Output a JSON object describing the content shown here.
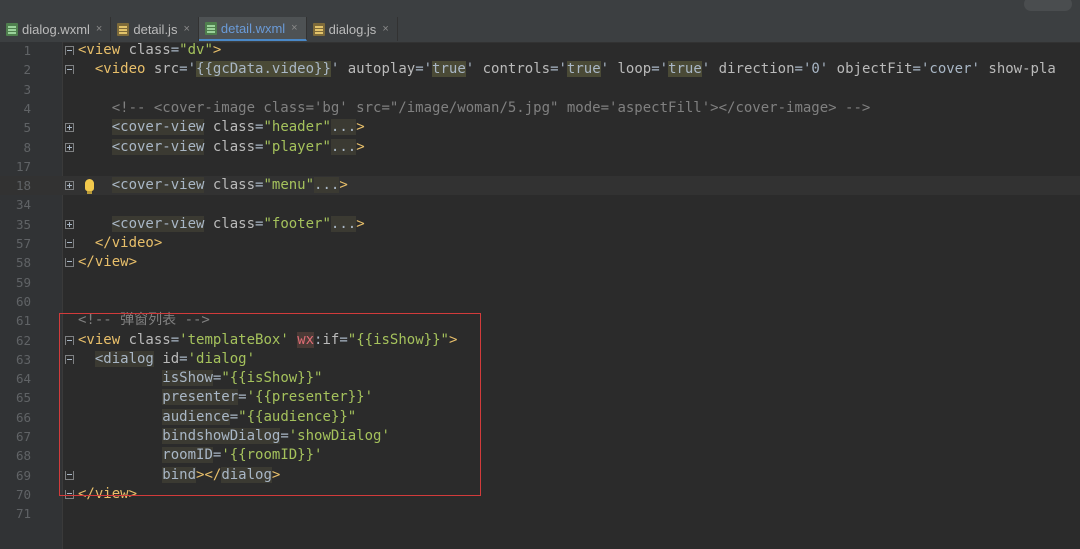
{
  "tabs": [
    {
      "label": "dialog.wxml",
      "icon": "wxml-file-icon",
      "active": false
    },
    {
      "label": "detail.js",
      "icon": "js-file-icon",
      "active": false
    },
    {
      "label": "detail.wxml",
      "icon": "wxml-file-icon",
      "active": true
    },
    {
      "label": "dialog.js",
      "icon": "js-file-icon",
      "active": false
    }
  ],
  "close_glyph": "×",
  "lines": [
    {
      "num": "1",
      "fold": "start",
      "segs": [
        [
          "tg",
          "<view "
        ],
        [
          "at",
          "class"
        ],
        [
          "",
          "="
        ],
        [
          "st",
          "\"dv\""
        ],
        [
          "tg",
          ">"
        ]
      ]
    },
    {
      "num": "2",
      "fold": "start",
      "segs": [
        [
          "",
          "  "
        ],
        [
          "tg",
          "<video "
        ],
        [
          "at",
          "src"
        ],
        [
          "",
          "='"
        ],
        [
          "hl2",
          "{{gcData.video}}"
        ],
        [
          "",
          "' "
        ],
        [
          "at",
          "autoplay"
        ],
        [
          "",
          "='"
        ],
        [
          "hl2",
          "true"
        ],
        [
          "",
          "' "
        ],
        [
          "at",
          "controls"
        ],
        [
          "",
          "='"
        ],
        [
          "hl2",
          "true"
        ],
        [
          "",
          "' "
        ],
        [
          "at",
          "loop"
        ],
        [
          "",
          "='"
        ],
        [
          "hl2",
          "true"
        ],
        [
          "",
          "' "
        ],
        [
          "at",
          "direction"
        ],
        [
          "",
          "='0' "
        ],
        [
          "at",
          "objectFit"
        ],
        [
          "",
          "='cover' "
        ],
        [
          "at",
          "show-pla"
        ]
      ]
    },
    {
      "num": "3",
      "fold": "",
      "segs": []
    },
    {
      "num": "4",
      "fold": "",
      "segs": [
        [
          "",
          "    "
        ],
        [
          "cm",
          "<!-- <cover-image class='bg' src=\"/image/woman/5.jpg\" mode='aspectFill'></cover-image> -->"
        ]
      ]
    },
    {
      "num": "5",
      "fold": "plus",
      "segs": [
        [
          "",
          "    "
        ],
        [
          "hl",
          "<cover-view"
        ],
        [
          "",
          " "
        ],
        [
          "at",
          "class"
        ],
        [
          "",
          "="
        ],
        [
          "st",
          "\"header\""
        ],
        [
          "hl",
          "..."
        ],
        [
          "tg",
          ">"
        ]
      ]
    },
    {
      "num": "8",
      "fold": "plus",
      "segs": [
        [
          "",
          "    "
        ],
        [
          "hl",
          "<cover-view"
        ],
        [
          "",
          " "
        ],
        [
          "at",
          "class"
        ],
        [
          "",
          "="
        ],
        [
          "st",
          "\"player\""
        ],
        [
          "hl",
          "..."
        ],
        [
          "tg",
          ">"
        ]
      ]
    },
    {
      "num": "17",
      "fold": "",
      "segs": []
    },
    {
      "num": "18",
      "fold": "plus",
      "bulb": true,
      "current": true,
      "segs": [
        [
          "",
          "    "
        ],
        [
          "hl",
          "<cover-view"
        ],
        [
          "",
          " "
        ],
        [
          "at",
          "class"
        ],
        [
          "",
          "="
        ],
        [
          "st",
          "\"menu\""
        ],
        [
          "hl",
          "..."
        ],
        [
          "tg",
          ">"
        ]
      ]
    },
    {
      "num": "34",
      "fold": "",
      "segs": []
    },
    {
      "num": "35",
      "fold": "plus",
      "segs": [
        [
          "",
          "    "
        ],
        [
          "hl",
          "<cover-view"
        ],
        [
          "",
          " "
        ],
        [
          "at",
          "class"
        ],
        [
          "",
          "="
        ],
        [
          "st",
          "\"footer\""
        ],
        [
          "hl",
          "..."
        ],
        [
          "tg",
          ">"
        ]
      ]
    },
    {
      "num": "57",
      "fold": "end",
      "segs": [
        [
          "",
          "  "
        ],
        [
          "tg",
          "</video>"
        ]
      ]
    },
    {
      "num": "58",
      "fold": "end",
      "segs": [
        [
          "tg",
          "</view>"
        ]
      ]
    },
    {
      "num": "59",
      "fold": "",
      "segs": []
    },
    {
      "num": "60",
      "fold": "",
      "segs": []
    },
    {
      "num": "61",
      "fold": "",
      "segs": [
        [
          "cm",
          "<!-- 弹窗列表 -->"
        ]
      ]
    },
    {
      "num": "62",
      "fold": "start",
      "segs": [
        [
          "tg",
          "<view "
        ],
        [
          "at",
          "class"
        ],
        [
          "",
          "="
        ],
        [
          "st",
          "'templateBox'"
        ],
        [
          "",
          " "
        ],
        [
          "wx",
          "wx"
        ],
        [
          "",
          ":"
        ],
        [
          "at",
          "if"
        ],
        [
          "",
          "="
        ],
        [
          "st",
          "\"{{isShow}}\""
        ],
        [
          "tg",
          ">"
        ]
      ]
    },
    {
      "num": "63",
      "fold": "start",
      "segs": [
        [
          "",
          "  "
        ],
        [
          "hl",
          "<dialog"
        ],
        [
          "",
          " "
        ],
        [
          "at",
          "id"
        ],
        [
          "",
          "="
        ],
        [
          "st",
          "'dialog'"
        ]
      ]
    },
    {
      "num": "64",
      "fold": "",
      "segs": [
        [
          "",
          "          "
        ],
        [
          "hl",
          "isShow"
        ],
        [
          "",
          "="
        ],
        [
          "st",
          "\"{{isShow}}\""
        ]
      ]
    },
    {
      "num": "65",
      "fold": "",
      "segs": [
        [
          "",
          "          "
        ],
        [
          "hl",
          "presenter"
        ],
        [
          "",
          "="
        ],
        [
          "st",
          "'{{presenter}}'"
        ]
      ]
    },
    {
      "num": "66",
      "fold": "",
      "segs": [
        [
          "",
          "          "
        ],
        [
          "hl",
          "audience"
        ],
        [
          "",
          "="
        ],
        [
          "st",
          "\"{{audience}}\""
        ]
      ]
    },
    {
      "num": "67",
      "fold": "",
      "segs": [
        [
          "",
          "          "
        ],
        [
          "hl",
          "bindshowDialog"
        ],
        [
          "",
          "="
        ],
        [
          "st",
          "'showDialog'"
        ]
      ]
    },
    {
      "num": "68",
      "fold": "",
      "segs": [
        [
          "",
          "          "
        ],
        [
          "hl",
          "roomID"
        ],
        [
          "",
          "="
        ],
        [
          "st",
          "'{{roomID}}'"
        ]
      ]
    },
    {
      "num": "69",
      "fold": "end",
      "segs": [
        [
          "",
          "          "
        ],
        [
          "hl",
          "bind"
        ],
        [
          "tg",
          ">"
        ],
        [
          "tg",
          "</"
        ],
        [
          "hl",
          "dialog"
        ],
        [
          "tg",
          ">"
        ]
      ]
    },
    {
      "num": "70",
      "fold": "end",
      "segs": [
        [
          "tg",
          "</view>"
        ]
      ]
    },
    {
      "num": "71",
      "fold": "",
      "segs": []
    }
  ]
}
